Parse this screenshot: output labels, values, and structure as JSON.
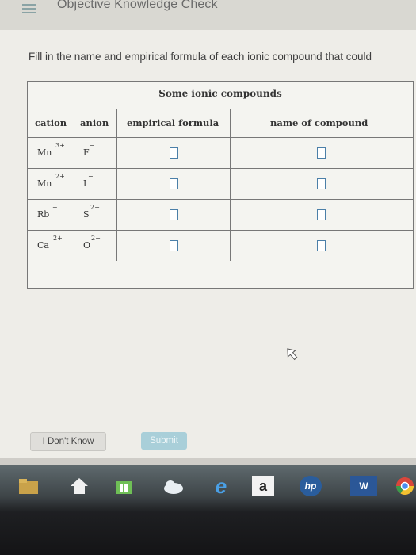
{
  "header": {
    "title": "Objective Knowledge Check"
  },
  "instruction": "Fill in the name and empirical formula of each ionic compound that could",
  "table": {
    "title": "Some ionic compounds",
    "columns": [
      "cation",
      "anion",
      "empirical formula",
      "name of compound"
    ],
    "rows": [
      {
        "cation_symbol": "Mn",
        "cation_charge": "3+",
        "anion_symbol": "F",
        "anion_charge": "−"
      },
      {
        "cation_symbol": "Mn",
        "cation_charge": "2+",
        "anion_symbol": "I",
        "anion_charge": "−"
      },
      {
        "cation_symbol": "Rb",
        "cation_charge": "+",
        "anion_symbol": "S",
        "anion_charge": "2−"
      },
      {
        "cation_symbol": "Ca",
        "cation_charge": "2+",
        "anion_symbol": "O",
        "anion_charge": "2−"
      }
    ]
  },
  "buttons": {
    "dont_know": "I Don't Know",
    "submit": "Submit"
  },
  "taskbar": {
    "icons": [
      "file-explorer-icon",
      "home-icon",
      "store-icon",
      "weather-icon",
      "edge-browser-icon",
      "amazon-icon",
      "hp-icon",
      "word-icon",
      "chrome-icon"
    ],
    "word_label": "W",
    "amazon_label": "a",
    "hp_label": "hp",
    "edge_label": "e"
  },
  "colors": {
    "accent": "#4b7fa8",
    "submit_bg": "#a9cfd9",
    "hamburger": "#8aa3a5"
  }
}
